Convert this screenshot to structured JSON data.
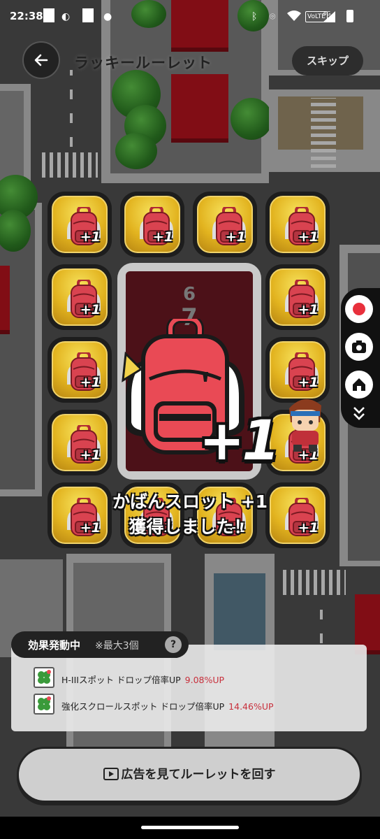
{
  "status_bar": {
    "time": "22:38",
    "network": "4G",
    "volte": "VoLTE"
  },
  "header": {
    "back_icon": "arrow-left-icon",
    "title": "ラッキールーレット",
    "skip_label": "スキップ"
  },
  "roulette": {
    "tile_badge": "+1",
    "tile_icon": "backpack-icon",
    "reel_numbers": [
      "6",
      "7"
    ]
  },
  "reward": {
    "icon": "backpack-icon",
    "amount": "+1",
    "line1": "かばんスロット +1",
    "line2": "獲得しました！"
  },
  "side_buttons": [
    "record-icon",
    "camera-icon",
    "home-icon",
    "chevrons-down-icon"
  ],
  "effects": {
    "tab_label": "効果発動中",
    "tab_note": "※最大3個",
    "help_label": "?",
    "items": [
      {
        "icon": "clover-icon",
        "label": "H-IIIスポット ドロップ倍率UP",
        "value": "9.08%UP"
      },
      {
        "icon": "clover-icon",
        "label": "強化スクロールスポット ドロップ倍率UP",
        "value": "14.46%UP"
      }
    ]
  },
  "bottom_button": {
    "icon": "play-icon",
    "label": "広告を見てルーレットを回す"
  },
  "colors": {
    "accent_red": "#e94a55",
    "tile_yellow": "#e2b31f",
    "effect_value": "#c8303c"
  }
}
